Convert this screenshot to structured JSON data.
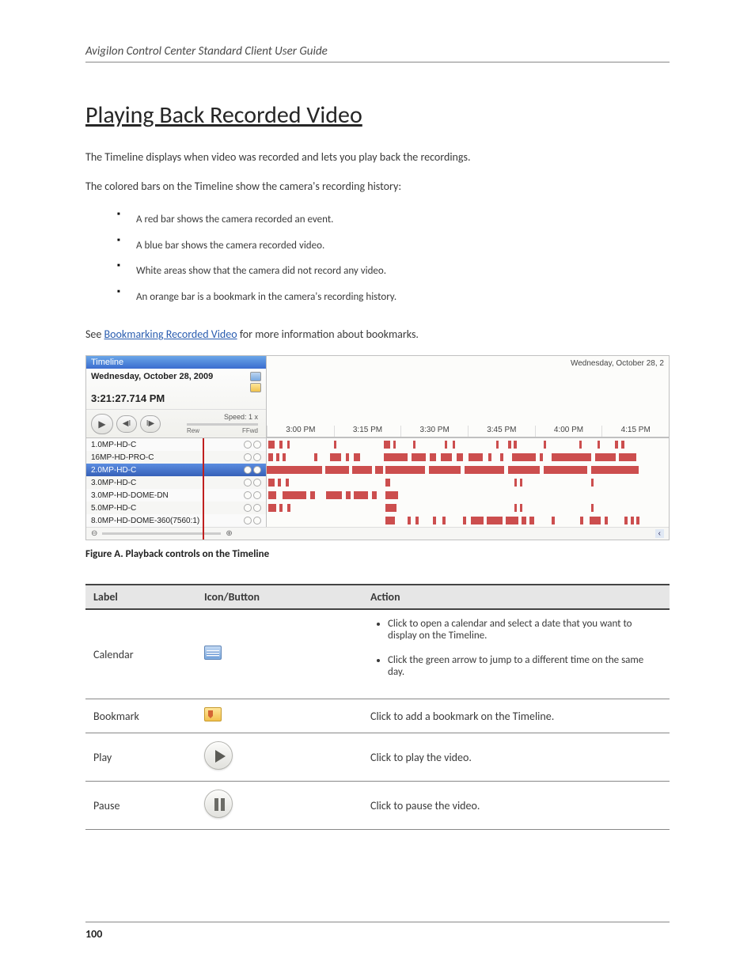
{
  "header": {
    "running": "Avigilon Control Center Standard Client User Guide"
  },
  "title": "Playing Back Recorded Video",
  "intro": "The Timeline displays when video was recorded and lets you play back the recordings.",
  "colors_intro": "The colored bars on the Timeline show the camera's recording history:",
  "colors": [
    "A red bar shows the camera recorded an event.",
    "A blue bar shows the camera recorded video.",
    "White areas show that the camera did not record any video.",
    "An orange bar is a bookmark in the camera's recording history."
  ],
  "note_prefix": "See ",
  "note_link": "Bookmarking Recorded Video",
  "note_suffix": " for more information about bookmarks.",
  "figure": {
    "caption": "Figure A. Playback controls on the Timeline",
    "panel_title": "Timeline",
    "date": "Wednesday, October 28, 2009",
    "time": "3:21:27.714 PM",
    "speed": "Speed: 1 x",
    "rew": "Rew",
    "ffwd": "FFwd",
    "ruler_date": "Wednesday, October 28, 2",
    "ticks": [
      "3:00 PM",
      "3:15 PM",
      "3:30 PM",
      "3:45 PM",
      "4:00 PM",
      "4:15 PM"
    ],
    "cameras": [
      {
        "name": "1.0MP-HD-C"
      },
      {
        "name": "16MP-HD-PRO-C"
      },
      {
        "name": "2.0MP-HD-C",
        "selected": true
      },
      {
        "name": "3.0MP-HD-C"
      },
      {
        "name": "3.0MP-HD-DOME-DN"
      },
      {
        "name": "5.0MP-HD-C"
      },
      {
        "name": "8.0MP-HD-DOME-360(7560:1)"
      }
    ]
  },
  "table": {
    "head": [
      "Label",
      "Icon/Button",
      "Action"
    ],
    "rows": [
      {
        "label": "Calendar",
        "icon": "calendar",
        "actions": [
          "Click to open a calendar and select a date that you want to display on the Timeline.",
          "Click the green arrow to jump to a different time on the same day."
        ]
      },
      {
        "label": "Bookmark",
        "icon": "bookmark",
        "action": "Click to add a bookmark on the Timeline."
      },
      {
        "label": "Play",
        "icon": "play",
        "action": "Click to play the video."
      },
      {
        "label": "Pause",
        "icon": "pause",
        "action": "Click to pause the video."
      }
    ]
  },
  "page_number": "100"
}
